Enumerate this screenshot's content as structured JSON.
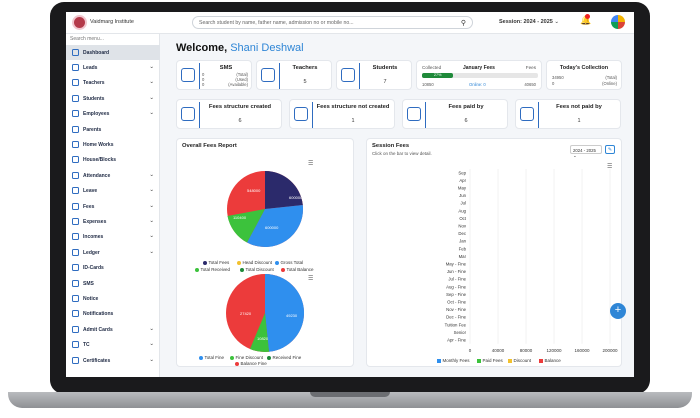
{
  "header": {
    "institute": "Vaidmarg Institute",
    "search_placeholder": "Search student by name, father name, admission no or mobile no...",
    "session_label": "Session:",
    "session_value": "2024 - 2025",
    "notif_count": "1"
  },
  "sidebar": {
    "search_placeholder": "Search menu...",
    "items": [
      {
        "label": "Dashboard",
        "chev": false,
        "active": true
      },
      {
        "label": "Leads",
        "chev": true
      },
      {
        "label": "Teachers",
        "chev": true
      },
      {
        "label": "Students",
        "chev": true
      },
      {
        "label": "Employees",
        "chev": true
      },
      {
        "label": "Parents",
        "chev": false
      },
      {
        "label": "Home Works",
        "chev": false
      },
      {
        "label": "House/Blocks",
        "chev": false
      },
      {
        "label": "Attendance",
        "chev": true
      },
      {
        "label": "Leave",
        "chev": true
      },
      {
        "label": "Fees",
        "chev": true
      },
      {
        "label": "Expenses",
        "chev": true
      },
      {
        "label": "Incomes",
        "chev": true
      },
      {
        "label": "Ledger",
        "chev": true
      },
      {
        "label": "ID-Cards",
        "chev": false
      },
      {
        "label": "SMS",
        "chev": false
      },
      {
        "label": "Notice",
        "chev": false
      },
      {
        "label": "Notifications",
        "chev": false
      },
      {
        "label": "Admit Cards",
        "chev": true
      },
      {
        "label": "TC",
        "chev": true
      },
      {
        "label": "Certificates",
        "chev": true
      }
    ]
  },
  "welcome": {
    "prefix": "Welcome,",
    "name": "Shani Deshwal"
  },
  "cards_row1": {
    "sms": {
      "title": "SMS",
      "lines": [
        "0",
        "0",
        "0"
      ],
      "labels": [
        "(Total)",
        "(Used)",
        "(Available)"
      ]
    },
    "teachers": {
      "title": "Teachers",
      "value": "5"
    },
    "students": {
      "title": "Students",
      "value": "7"
    },
    "fees": {
      "collected_label": "Collected",
      "title": "January Fees",
      "fees_label": "Fees",
      "progress_text": "27%",
      "progress": 0.27,
      "collected": "10850",
      "online": "Online: 0",
      "total": "40650"
    },
    "collection": {
      "title": "Today's Collection",
      "v1": "34950",
      "l1": "(Total)",
      "v2": "0",
      "l2": "(Online)"
    }
  },
  "cards_row2": [
    {
      "title": "Fees structure created",
      "value": "6"
    },
    {
      "title": "Fees structure not created",
      "value": "1"
    },
    {
      "title": "Fees paid by",
      "value": "6"
    },
    {
      "title": "Fees not paid by",
      "value": "1"
    }
  ],
  "overall": {
    "title": "Overall Fees Report",
    "pie1_labels": [
      "548000",
      "600000",
      "110400",
      "600000"
    ],
    "legend1": [
      "Total Fees",
      "Head Discount",
      "Gross Total",
      "Total Received",
      "Total Discount",
      "Total Balance"
    ],
    "pie2_labels": [
      "27420",
      "49230",
      "10820"
    ],
    "legend2": [
      "Total Fine",
      "Fine Discount",
      "Received Fine",
      "Balance Fine"
    ]
  },
  "session_fees": {
    "title": "Session Fees",
    "subtitle": "Click on the bar to view detail.",
    "select": "2024 - 2025",
    "categories": [
      "Sep",
      "Apr",
      "May",
      "Jun",
      "Jul",
      "Aug",
      "Oct",
      "Nov",
      "Dec",
      "Jan",
      "Feb",
      "Mar",
      "May - Fine",
      "Jun - Fine",
      "Jul - Fine",
      "Aug - Fine",
      "Sep - Fine",
      "Oct - Fine",
      "Nov - Fine",
      "Dec - Fine",
      "Tuition Fee",
      "Senior",
      "Apr - Fine"
    ],
    "x_ticks": [
      "0",
      "40000",
      "80000",
      "120000",
      "160000",
      "200000"
    ],
    "legend": [
      "Monthly Fees",
      "Paid Fees",
      "Discount",
      "Balance"
    ]
  },
  "colors": {
    "primary": "#2f86d6",
    "pie_navy": "#2b2a6b",
    "pie_blue": "#2f8fee",
    "pie_green": "#3cc23c",
    "pie_red": "#ec3b3b"
  }
}
